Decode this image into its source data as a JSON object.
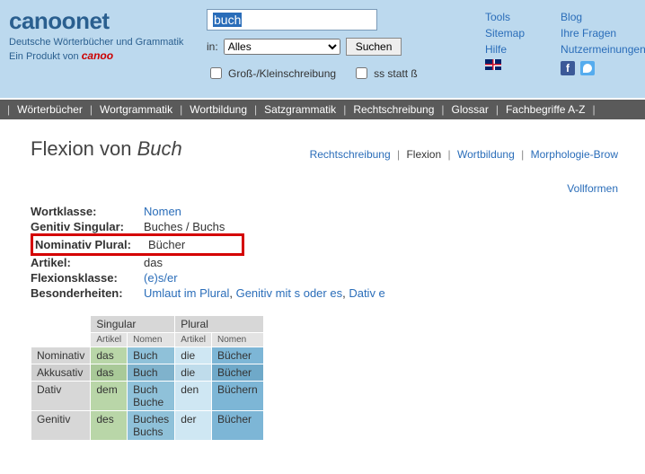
{
  "brand": {
    "logo_a": "canoo",
    "logo_b": "net",
    "tagline": "Deutsche Wörterbücher und Grammatik",
    "product_prefix": "Ein Produkt von ",
    "product_name": "canoo"
  },
  "search": {
    "value": "buch",
    "in_label": "in:",
    "select_value": "Alles",
    "button": "Suchen",
    "opt_case": "Groß-/Kleinschreibung",
    "opt_ss": "ss statt ß"
  },
  "toplinks": {
    "col1": [
      "Tools",
      "Sitemap",
      "Hilfe"
    ],
    "col2": [
      "Blog",
      "Ihre Fragen",
      "Nutzermeinungen"
    ]
  },
  "nav": [
    "Wörterbücher",
    "Wortgrammatik",
    "Wortbildung",
    "Satzgrammatik",
    "Rechtschreibung",
    "Glossar",
    "Fachbegriffe A-Z"
  ],
  "page": {
    "title_pre": "Flexion von ",
    "title_word": "Buch",
    "tabs": [
      "Rechtschreibung",
      "Flexion",
      "Wortbildung",
      "Morphologie-Brow"
    ],
    "right_link": "Vollformen"
  },
  "info": {
    "rows": [
      {
        "label": "Wortklasse:",
        "v": "Nomen",
        "link": true
      },
      {
        "label": "Genitiv Singular:",
        "v": "Buches / Buchs"
      },
      {
        "label": "Nominativ Plural:",
        "v": "Bücher",
        "highlight": true
      },
      {
        "label": "Artikel:",
        "v": "das"
      },
      {
        "label": "Flexionsklasse:",
        "v": "(e)s/er",
        "link": true
      }
    ],
    "spec_label": "Besonderheiten:",
    "spec_links": [
      "Umlaut im Plural",
      "Genitiv mit s oder es",
      "Dativ e"
    ]
  },
  "decl": {
    "groups": [
      "Singular",
      "Plural"
    ],
    "subs": [
      "Artikel",
      "Nomen"
    ],
    "rows": [
      {
        "case": "Nominativ",
        "as": "das",
        "ns": "Buch",
        "ap": "die",
        "np": "Bücher",
        "d": 0
      },
      {
        "case": "Akkusativ",
        "as": "das",
        "ns": "Buch",
        "ap": "die",
        "np": "Bücher",
        "d": 1
      },
      {
        "case": "Dativ",
        "as": "dem",
        "ns": "Buch\nBuche",
        "ap": "den",
        "np": "Büchern",
        "d": 0
      },
      {
        "case": "Genitiv",
        "as": "des",
        "ns": "Buches\nBuchs",
        "ap": "der",
        "np": "Bücher",
        "d": 0
      }
    ]
  }
}
